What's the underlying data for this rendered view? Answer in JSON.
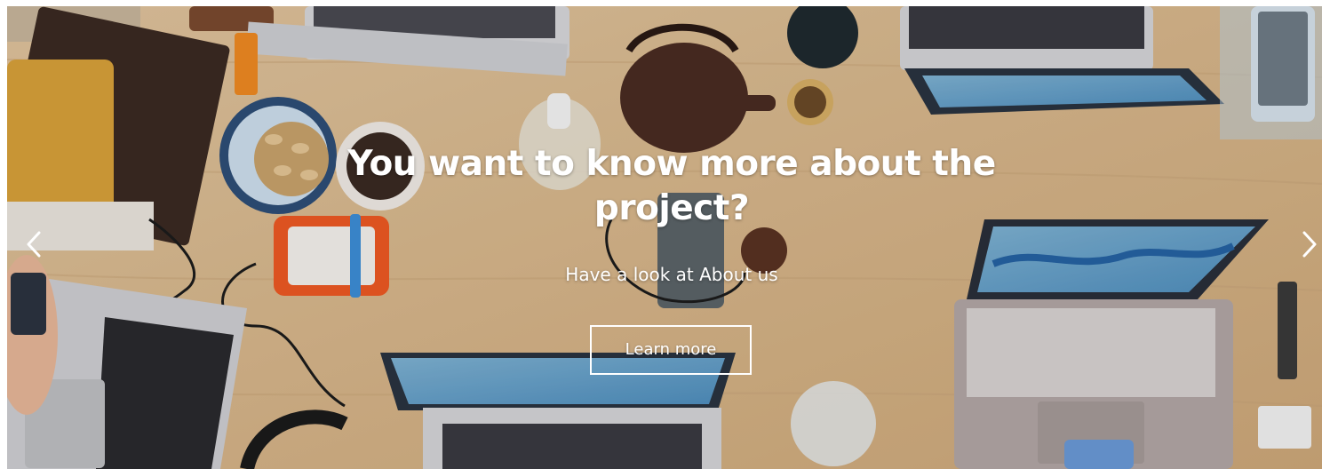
{
  "hero": {
    "title": "You want to know more about the project?",
    "subtitle": "Have a look at About us",
    "cta_label": "Learn more",
    "background_description_icon": "desk-workspace-photo",
    "text_color": "#ffffff"
  },
  "carousel": {
    "prev_icon": "chevron-left-icon",
    "next_icon": "chevron-right-icon"
  }
}
